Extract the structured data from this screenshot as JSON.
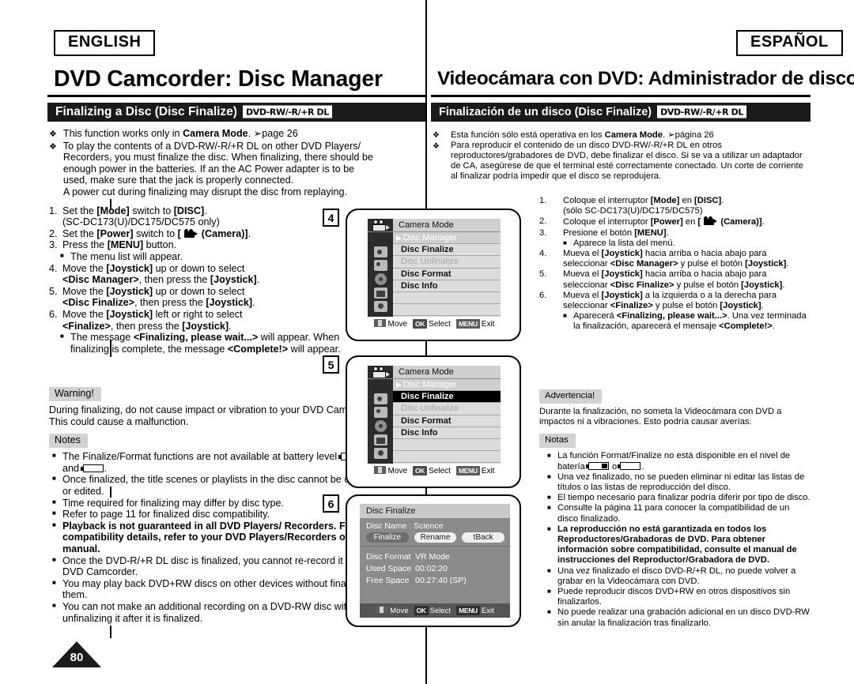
{
  "header": {
    "lang_en": "ENGLISH",
    "lang_es": "ESPAÑOL",
    "title_en": "DVD Camcorder: Disc Manager",
    "title_es": "Videocámara con DVD: Administrador de discos",
    "section_en": "Finalizing a Disc (Disc Finalize)",
    "section_es": "Finalización de un disco (Disc Finalize)",
    "disc_badge": "DVD-RW/-R/+R DL"
  },
  "english": {
    "intro": [
      "This function works only in <b>Camera Mode</b>. <span class=\"arrowref\">&#10146;</span>page 26",
      "To play the contents of a DVD-RW/-R/+R DL on other DVD Players/ Recorders, you must finalize the disc. When finalizing, there should be enough power in the batteries. If an the AC Power adapter is to be used, make sure that the jack is properly connected.<br>A power cut during finalizing may disrupt the disc from replaying."
    ],
    "steps": [
      {
        "n": "1.",
        "text": "Set the <b>[Mode]</b> switch to <b>[DISC]</b>.<br>(SC-DC173(U)/DC175/DC575 only)"
      },
      {
        "n": "2.",
        "text": "Set the <b>[Power]</b> switch to <b>[ <span class=\"camglyph\"><span class=\"r1\"></span><span class=\"r2\"></span><span class=\"body\"></span><span class=\"lens\"></span></span> (Camera)]</b>."
      },
      {
        "n": "3.",
        "text": "Press the <b>[MENU]</b> button."
      },
      {
        "n": "3s",
        "text": "The menu list will appear."
      },
      {
        "n": "4.",
        "text": "Move the <b>[Joystick]</b> up or down to select<br><b>&lt;Disc Manager&gt;</b>, then press the <b>[Joystick]</b>."
      },
      {
        "n": "5.",
        "text": "Move the <b>[Joystick]</b> up or down to select<br><b>&lt;Disc Finalize&gt;</b>, then press the <b>[Joystick]</b>."
      },
      {
        "n": "6.",
        "text": "Move the <b>[Joystick]</b> left or right to select<br><b>&lt;Finalize&gt;</b>, then press the <b>[Joystick]</b>."
      },
      {
        "n": "6s",
        "text": "The message <b>&lt;Finalizing, please wait...&gt;</b> will appear. When finalizing is complete, the message <b>&lt;Complete!&gt;</b> will appear."
      }
    ],
    "warning_label": "Warning!",
    "warning_text": "During finalizing, do not cause impact or vibration to your DVD Camcorder. This could cause a malfunction.",
    "notes_label": "Notes",
    "notes": [
      "The Finalize/Format functions are not available at battery level <span class=\"batt half\"></span> and <span class=\"batt\"></span>.",
      "Once finalized, the title scenes or playlists in the disc cannot be deleted or edited.",
      "Time required for finalizing may differ by disc type.",
      "Refer to page 11 for finalized disc compatibility.",
      "<b>Playback is not guaranteed in all DVD Players/ Recorders. For compatibility details, refer to your DVD Players/Recorders owner's manual.</b>",
      "Once the DVD-R/+R DL disc is finalized, you cannot re-record it in the DVD Camcorder.",
      "You may play back DVD+RW discs on other devices without finalizing them.",
      "You can not make an additional recording on a DVD-RW disc without unfinalizing it after it is finalized."
    ]
  },
  "spanish": {
    "intro": [
      "Esta función sólo está operativa en los <b>Camera Mode</b>. <span class=\"arrowref\">&#10146;</span>página 26",
      "Para reproducir el contenido de un disco DVD-RW/-R/+R DL en otros reproductores/grabadores de DVD, debe finalizar el disco. Si se va a utilizar un adaptador de CA, asegúrese de que el terminal esté correctamente conectado. Un corte de corriente al finalizar podría impedir que el disco se reprodujera."
    ],
    "steps": [
      {
        "n": "1.",
        "text": "Coloque el interruptor <b>[Mode]</b> en <b>[DISC]</b>.<br>(sólo SC-DC173(U)/DC175/DC575)"
      },
      {
        "n": "2.",
        "text": "Coloque el interruptor <b>[Power]</b> en <b>[ <span class=\"camglyph\"><span class=\"r1\"></span><span class=\"r2\"></span><span class=\"body\"></span><span class=\"lens\"></span></span> (Camera)]</b>."
      },
      {
        "n": "3.",
        "text": "Presione el botón <b>[MENU]</b>."
      },
      {
        "n": "3s",
        "text": "Aparece la lista del menú."
      },
      {
        "n": "4.",
        "text": "Mueva el <b>[Joystick]</b> hacia arriba o hacia abajo para seleccionar <b>&lt;Disc Manager&gt;</b> y pulse el botón <b>[Joystick]</b>."
      },
      {
        "n": "5.",
        "text": "Mueva el <b>[Joystick]</b> hacia arriba o hacia abajo para seleccionar <b>&lt;Disc Finalize&gt;</b> y pulse el botón <b>[Joystick]</b>."
      },
      {
        "n": "6.",
        "text": "Mueva el <b>[Joystick]</b> a la izquierda o a la derecha para seleccionar <b>&lt;Finalize&gt;</b> y pulse el botón <b>[Joystick]</b>."
      },
      {
        "n": "6s",
        "text": "Aparecerá <b>&lt;Finalizing, please wait...&gt;</b>. Una vez terminada la finalización, aparecerá el mensaje <b>&lt;Complete!&gt;</b>."
      }
    ],
    "warning_label": "Advertencia!",
    "warning_text": "Durante la finalización, no someta la Videocámara con DVD a impactos ni a vibraciones. Esto podría causar averías.",
    "notes_label": "Notas",
    "notes": [
      "La función Format/Finalize no está disponible en el nivel de batería <span class=\"batt half\"></span> o <span class=\"batt\"></span>.",
      "Una vez finalizado, no se pueden eliminar ni editar las listas de títulos o las listas de reproducción del disco.",
      "El tiempo necesario para finalizar podría diferir por tipo de disco.",
      "Consulte la página 11 para conocer la compatibilidad de un disco finalizado.",
      "<b>La reproducción no está garantizada en todos los Reproductores/Grabadoras de DVD. Para obtener información sobre compatibilidad, consulte el manual de instrucciones del Reproductor/Grabadora de DVD.</b>",
      "Una vez finalizado el disco DVD-R/+R DL, no puede volver a grabar en la Videocámara con DVD.",
      "Puede reproducir discos DVD+RW en otros dispositivos sin finalizarlos.",
      "No puede realizar una grabación adicional en un disco DVD-RW sin anular la finalización tras finalizarlo."
    ]
  },
  "lcd_screens": {
    "screen4": {
      "step": "4",
      "mode_label": "Camera Mode",
      "items": [
        {
          "label": "Disc Manager",
          "state": "header-sel"
        },
        {
          "label": "Disc Finalize",
          "state": "bold"
        },
        {
          "label": "Disc Unfinalize",
          "state": "dimmed"
        },
        {
          "label": "Disc Format",
          "state": "bold"
        },
        {
          "label": "Disc Info",
          "state": "bold"
        }
      ]
    },
    "screen5": {
      "step": "5",
      "mode_label": "Camera Mode",
      "items": [
        {
          "label": "Disc Manager",
          "state": "header-sel"
        },
        {
          "label": "Disc Finalize",
          "state": "selected"
        },
        {
          "label": "Disc Unfinalize",
          "state": "dimmed"
        },
        {
          "label": "Disc Format",
          "state": "bold"
        },
        {
          "label": "Disc Info",
          "state": "bold"
        }
      ]
    },
    "screen6": {
      "step": "6",
      "title": "Disc Finalize",
      "disc_name": "Disc Name : Science",
      "buttons": [
        {
          "label": "Finalize",
          "selected": true
        },
        {
          "label": "Rename",
          "selected": false
        },
        {
          "label": "tBack",
          "selected": false
        }
      ],
      "rows": [
        {
          "label": "Disc Format",
          "value": "VR Mode"
        },
        {
          "label": "Used Space",
          "value": "00:02:20"
        },
        {
          "label": "Free Space",
          "value": "00:27:40 (SP)"
        }
      ]
    },
    "footer": {
      "move": "Move",
      "ok": "OK",
      "select": "Select",
      "menu": "MENU",
      "exit": "Exit"
    }
  },
  "page_number": "80"
}
